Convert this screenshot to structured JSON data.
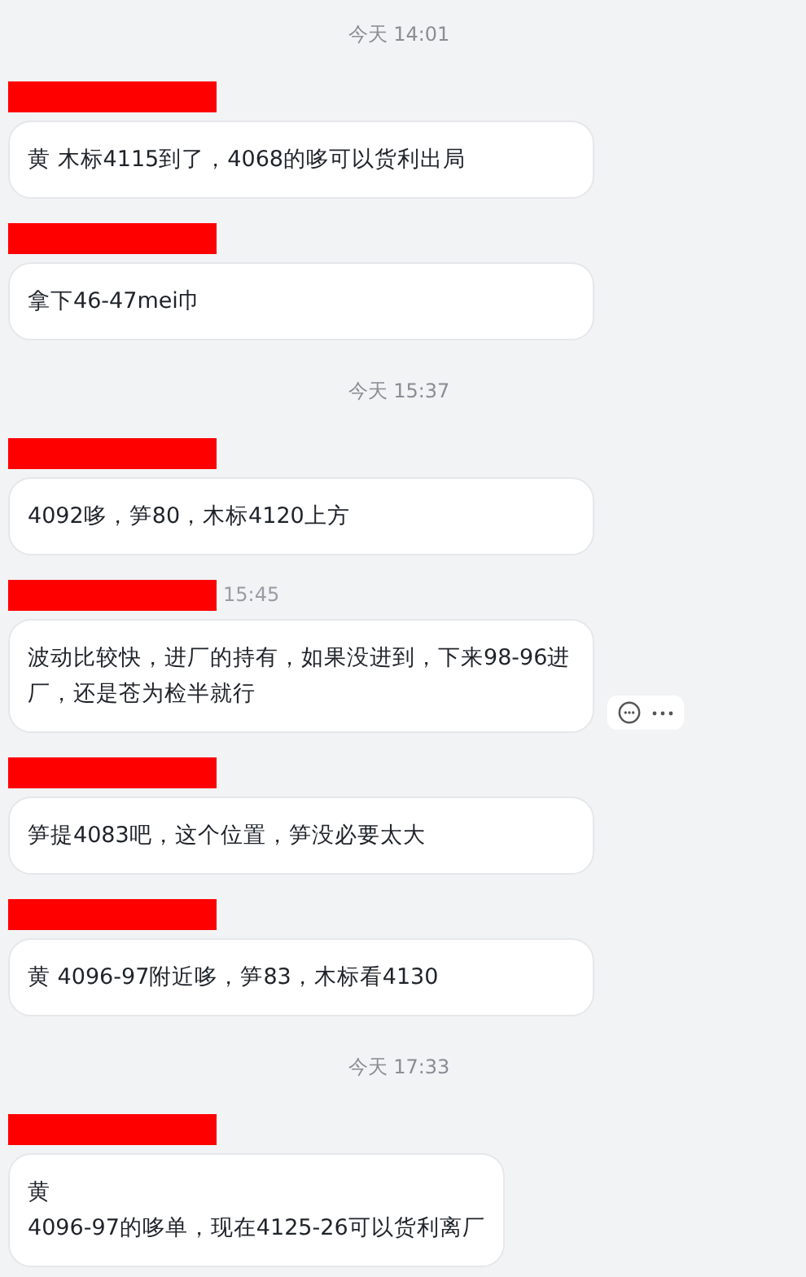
{
  "items": [
    {
      "kind": "time",
      "text": "今天 14:01"
    },
    {
      "kind": "message",
      "actions": false,
      "lines": [
        "黄 木标4115到了，4068的哆可以货利出局"
      ]
    },
    {
      "kind": "message",
      "actions": false,
      "lines": [
        "拿下46-47mei巾"
      ]
    },
    {
      "kind": "time",
      "text": "今天 15:37"
    },
    {
      "kind": "message",
      "actions": false,
      "lines": [
        "4092哆，笋80，木标4120上方"
      ]
    },
    {
      "kind": "message",
      "time": "15:45",
      "actions": true,
      "lines": [
        "波动比较快，进厂的持有，如果没进到，下来98-96进厂，还是苍为检半就行"
      ]
    },
    {
      "kind": "message",
      "actions": false,
      "lines": [
        "笋提4083吧，这个位置，笋没必要太大"
      ]
    },
    {
      "kind": "message",
      "actions": false,
      "lines": [
        "黄 4096-97附近哆，笋83，木标看4130"
      ]
    },
    {
      "kind": "time",
      "text": "今天 17:33"
    },
    {
      "kind": "message",
      "actions": false,
      "lines": [
        "黄",
        "4096-97的哆单，现在4125-26可以货利离厂"
      ]
    }
  ]
}
